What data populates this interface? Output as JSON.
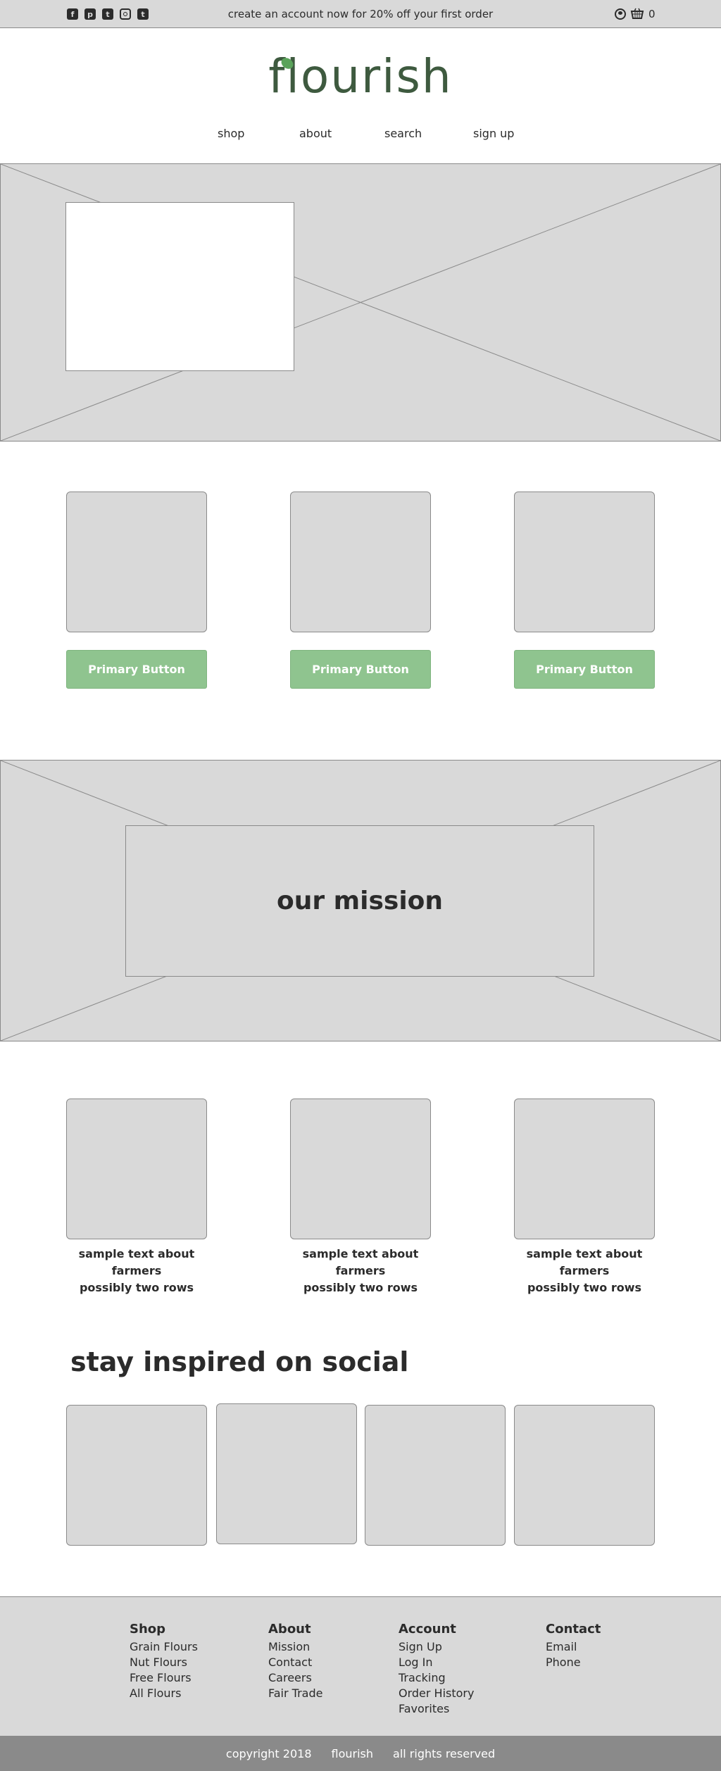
{
  "topbar": {
    "social_icons": [
      "facebook-icon",
      "pinterest-icon",
      "twitter-icon",
      "instagram-icon",
      "tumblr-icon"
    ],
    "promo": "create an account now for 20% off your first order",
    "cart_count": "0"
  },
  "brand": {
    "name": "flourish",
    "leaf_color": "#5aa35a",
    "text_color": "#3e5a3f"
  },
  "nav": {
    "shop": "shop",
    "about": "about",
    "search": "search",
    "signup": "sign up"
  },
  "featured": {
    "button_1": "Primary Button",
    "button_2": "Primary Button",
    "button_3": "Primary Button"
  },
  "mission": {
    "title": "our mission"
  },
  "farmers": {
    "caption_1": [
      "sample text about farmers",
      "possibly two rows"
    ],
    "caption_2": [
      "sample text about farmers",
      "possibly two rows"
    ],
    "caption_3": [
      "sample text about farmers",
      "possibly two rows"
    ]
  },
  "social": {
    "title": "stay inspired on social"
  },
  "footer": {
    "shop": {
      "title": "Shop",
      "links": [
        "Grain Flours",
        "Nut Flours",
        "Free Flours",
        "All Flours"
      ]
    },
    "about": {
      "title": "About",
      "links": [
        "Mission",
        "Contact",
        "Careers",
        "Fair Trade"
      ]
    },
    "account": {
      "title": "Account",
      "links": [
        "Sign Up",
        "Log In",
        "Tracking",
        "Order History",
        "Favorites"
      ]
    },
    "contact": {
      "title": "Contact",
      "links": [
        "Email",
        "Phone"
      ]
    },
    "copyright": {
      "year": "copyright 2018",
      "brand": "flourish",
      "rights": "all rights reserved"
    }
  },
  "colors": {
    "placeholder": "#d9d9d9",
    "border": "#8a8a8a",
    "button": "#8fc48f",
    "copyright_bar": "#8a8a8a"
  }
}
